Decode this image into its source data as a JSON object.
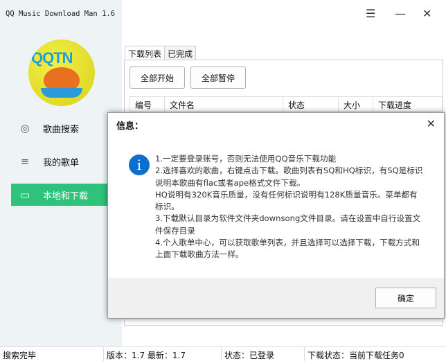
{
  "app": {
    "title": "QQ Music Download Man 1.6",
    "logo_text": "QQTN.com"
  },
  "window": {
    "menu_icon": "☰",
    "minimize_icon": "—",
    "close_icon": "✕"
  },
  "sidebar": {
    "items": [
      {
        "label": "歌曲搜索",
        "icon": "music-note-circle-icon"
      },
      {
        "label": "我的歌单",
        "icon": "playlist-icon"
      },
      {
        "label": "本地和下载",
        "icon": "monitor-icon",
        "active": true
      }
    ]
  },
  "main": {
    "tabs": [
      "下载列表",
      "已完成"
    ],
    "start_all": "全部开始",
    "pause_all": "全部暂停",
    "columns": [
      "编号",
      "文件名",
      "状态",
      "大小",
      "下载进度"
    ]
  },
  "dialog": {
    "title": "信息：",
    "lines": [
      "1.一定要登录账号，否则无法使用QQ音乐下载功能",
      "2.选择喜欢的歌曲，右键点击下载。歌曲列表有SQ和HQ标识，有SQ是标识说明本歌曲有flac或者ape格式文件下载。",
      "HQ说明有320K音乐质量，没有任何标识说明有128K质量音乐。菜单都有标识。",
      "3.下载默认目录为软件文件夹downsong文件目录。请在设置中自行设置文件保存目录",
      "4.个人歌单中心，可以获取歌单列表，并且选择可以选择下载，下载方式和上面下载歌曲方法一样。"
    ],
    "ok": "确定"
  },
  "status": {
    "search": "搜索完毕",
    "version": "版本：1.7 最新：1.7",
    "login": "状态：已登录",
    "download": "下载状态：当前下载任务0"
  }
}
